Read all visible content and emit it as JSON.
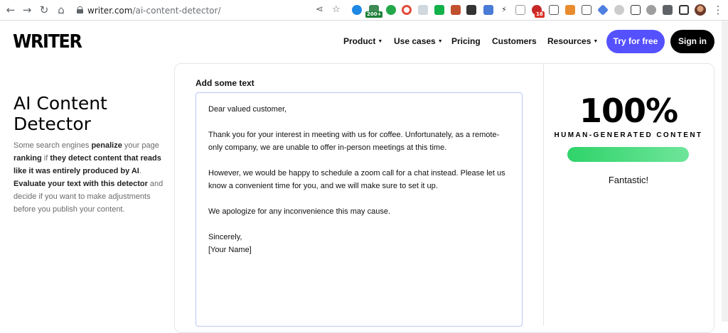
{
  "browser": {
    "url_host": "writer.com",
    "url_path": "/ai-content-detector/",
    "ext_badges": [
      "200+",
      "18"
    ]
  },
  "header": {
    "logo": "WRITER",
    "nav": [
      {
        "label": "Product",
        "dropdown": true
      },
      {
        "label": "Use cases",
        "dropdown": true
      },
      {
        "label": "Pricing",
        "dropdown": false
      },
      {
        "label": "Customers",
        "dropdown": false
      },
      {
        "label": "Resources",
        "dropdown": true
      }
    ],
    "try_label": "Try for free",
    "sign_label": "Sign in",
    "accent_color": "#5551ff"
  },
  "hero": {
    "title": "AI Content Detector",
    "description_parts": [
      {
        "text": "Some search engines ",
        "bold": false
      },
      {
        "text": "penalize",
        "bold": true
      },
      {
        "text": " your page ",
        "bold": false
      },
      {
        "text": "ranking",
        "bold": true
      },
      {
        "text": " if ",
        "bold": false
      },
      {
        "text": "they detect content that reads like it was entirely produced by AI",
        "bold": true
      },
      {
        "text": ". ",
        "bold": false
      },
      {
        "text": "Evaluate your text with this detector",
        "bold": true
      },
      {
        "text": " and decide if you want to make adjustments before you publish your content.",
        "bold": false
      }
    ]
  },
  "editor": {
    "label": "Add some text",
    "lines": [
      "Dear valued customer,",
      "",
      "Thank you for your interest in meeting with us for coffee. Unfortunately, as a remote-only company, we are unable to offer in-person meetings at this time.",
      "",
      "However, we would be happy to schedule a zoom call for a chat instead. Please let us know a convenient time for you, and we will make sure to set it up.",
      "",
      "We apologize for any inconvenience this may cause.",
      "",
      "Sincerely,",
      "[Your Name]"
    ]
  },
  "result": {
    "score": "100%",
    "label": "HUMAN-GENERATED CONTENT",
    "fill_fraction": 1.0,
    "bar_color": "#2fd36a",
    "verdict": "Fantastic!"
  }
}
